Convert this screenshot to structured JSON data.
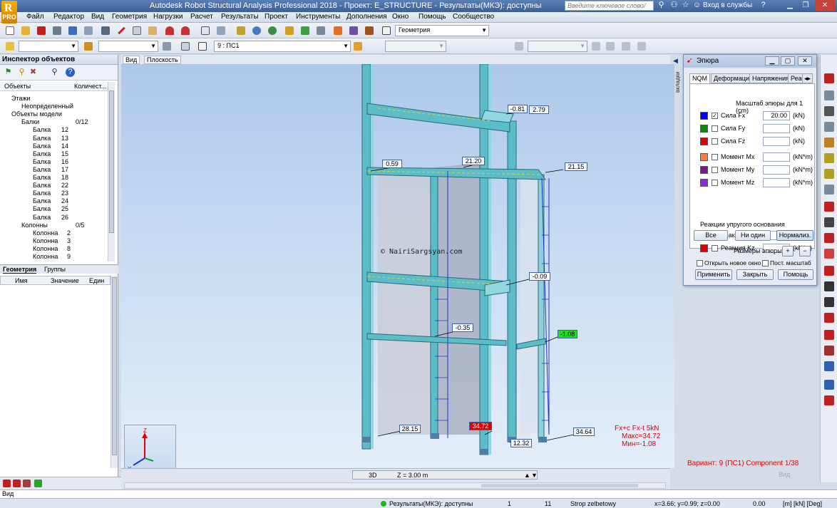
{
  "app": {
    "window_title": "Autodesk Robot Structural Analysis Professional 2018 - Проект: E_STRUCTURE - Результаты(МКЭ): доступны",
    "search_placeholder": "Введите ключевое слово/фразу",
    "login_label": "Вход в службы",
    "logo_letter": "R",
    "logo_badge": "PRO"
  },
  "menu": [
    "Файл",
    "Редактор",
    "Вид",
    "Геометрия",
    "Нагрузки",
    "Расчет",
    "Результаты",
    "Проект",
    "Инструменты",
    "Дополнения",
    "Окно",
    "Помощь",
    "Сообщество"
  ],
  "toolbar": {
    "layout_combo": "Геометрия",
    "load_case_combo": "9 : ПС1"
  },
  "inspector": {
    "title": "Инспектор объектов",
    "col_objects": "Объекты",
    "col_count": "Количест...",
    "tree": [
      {
        "label": "Этажи",
        "count": ""
      },
      {
        "label": "Неопределенный",
        "count": ""
      },
      {
        "label": "Объекты модели",
        "count": ""
      },
      {
        "label": "Балки",
        "count": "0/12"
      },
      {
        "label": "Балка",
        "count": "12"
      },
      {
        "label": "Балка",
        "count": "13"
      },
      {
        "label": "Балка",
        "count": "14"
      },
      {
        "label": "Балка",
        "count": "15"
      },
      {
        "label": "Балка",
        "count": "16"
      },
      {
        "label": "Балка",
        "count": "17"
      },
      {
        "label": "Балка",
        "count": "18"
      },
      {
        "label": "Балка",
        "count": "22"
      },
      {
        "label": "Балка",
        "count": "23"
      },
      {
        "label": "Балка",
        "count": "24"
      },
      {
        "label": "Балка",
        "count": "25"
      },
      {
        "label": "Балка",
        "count": "26"
      },
      {
        "label": "Колонны",
        "count": "0/5"
      },
      {
        "label": "Колонна",
        "count": "2"
      },
      {
        "label": "Колонна",
        "count": "3"
      },
      {
        "label": "Колонна",
        "count": "8"
      },
      {
        "label": "Колонна",
        "count": "9"
      }
    ],
    "tabs": [
      "Геометрия",
      "Группы"
    ],
    "prop_cols": [
      "Имя",
      "Значение",
      "Един"
    ]
  },
  "view": {
    "tabs": [
      "Вид",
      "Плоскость"
    ],
    "watermark": "© NairiSargsyan.com",
    "mode_label": "3D",
    "z_label": "Z = 3.00 m",
    "side_tab": "вкладки",
    "labels": [
      {
        "id": "l1",
        "text": "-0.81"
      },
      {
        "id": "l2",
        "text": "2.79"
      },
      {
        "id": "l3",
        "text": "0.59"
      },
      {
        "id": "l4",
        "text": "21.20"
      },
      {
        "id": "l5",
        "text": "21.15"
      },
      {
        "id": "l6",
        "text": "-0.09"
      },
      {
        "id": "l7",
        "text": "-0.35"
      },
      {
        "id": "l8",
        "text": "-1.08"
      },
      {
        "id": "l9",
        "text": "28.15"
      },
      {
        "id": "l10",
        "text": "34.72"
      },
      {
        "id": "l11",
        "text": "12.32"
      },
      {
        "id": "l12",
        "text": "34.64"
      }
    ],
    "legend": {
      "line1": "Fx+c Fx-t  5kN",
      "max": "Макс=34.72",
      "min": "Мин=-1.08"
    },
    "variant": "Вариант: 9 (ПС1) Component 1/38",
    "watermark_vid": "Вид"
  },
  "dialog": {
    "title": "Эпюра",
    "tabs": [
      "NQM",
      "Деформация",
      "Напряжения",
      "Реа"
    ],
    "scale_label": "Масштаб эпюры для 1  (cm)",
    "forces": [
      {
        "id": "fx",
        "label": "Сила Fx",
        "value": "20.00",
        "unit": "(kN)",
        "color": "#0000ff",
        "checked": true
      },
      {
        "id": "fy",
        "label": "Сила Fy",
        "value": "",
        "unit": "(kN)",
        "color": "#0a8a0a",
        "checked": false
      },
      {
        "id": "fz",
        "label": "Сила Fz",
        "value": "",
        "unit": "(kN)",
        "color": "#e00000",
        "checked": false
      },
      {
        "id": "mx",
        "label": "Момент Mx",
        "value": "",
        "unit": "(kN*m)",
        "color": "#f08040",
        "checked": false
      },
      {
        "id": "my",
        "label": "Момент My",
        "value": "",
        "unit": "(kN*m)",
        "color": "#7a1a8a",
        "checked": false
      },
      {
        "id": "mz",
        "label": "Момент Mz",
        "value": "",
        "unit": "(kN*m)",
        "color": "#8a2be2",
        "checked": false
      }
    ],
    "reactions_title": "Реакции упругого основания",
    "reactions": [
      {
        "id": "ky",
        "label": "Реакция Ky",
        "value": "",
        "unit": "(kN/m)",
        "color": "#0a8a0a"
      },
      {
        "id": "kz",
        "label": "Реакция Kz",
        "value": "",
        "unit": "(kN/m)",
        "color": "#e00000"
      }
    ],
    "btn_all": "Все",
    "btn_none": "Ни один",
    "btn_normalize": "Нормализ.",
    "sizes_label": "Размеры эпюры:",
    "open_new_window": "Открыть новое окно",
    "const_scale": "Пост. масштаб",
    "btn_apply": "Применить",
    "btn_close": "Закрыть",
    "btn_help": "Помощь"
  },
  "status": {
    "cmd": "Вид",
    "results": "Результаты(МКЭ): доступны",
    "n1": "1",
    "n2": "11",
    "section": "Strop zelbetowy",
    "coords": "x=3.66; y=0.99; z=0.00",
    "value": "0.00",
    "units": "[m] [kN] [Deg]"
  }
}
